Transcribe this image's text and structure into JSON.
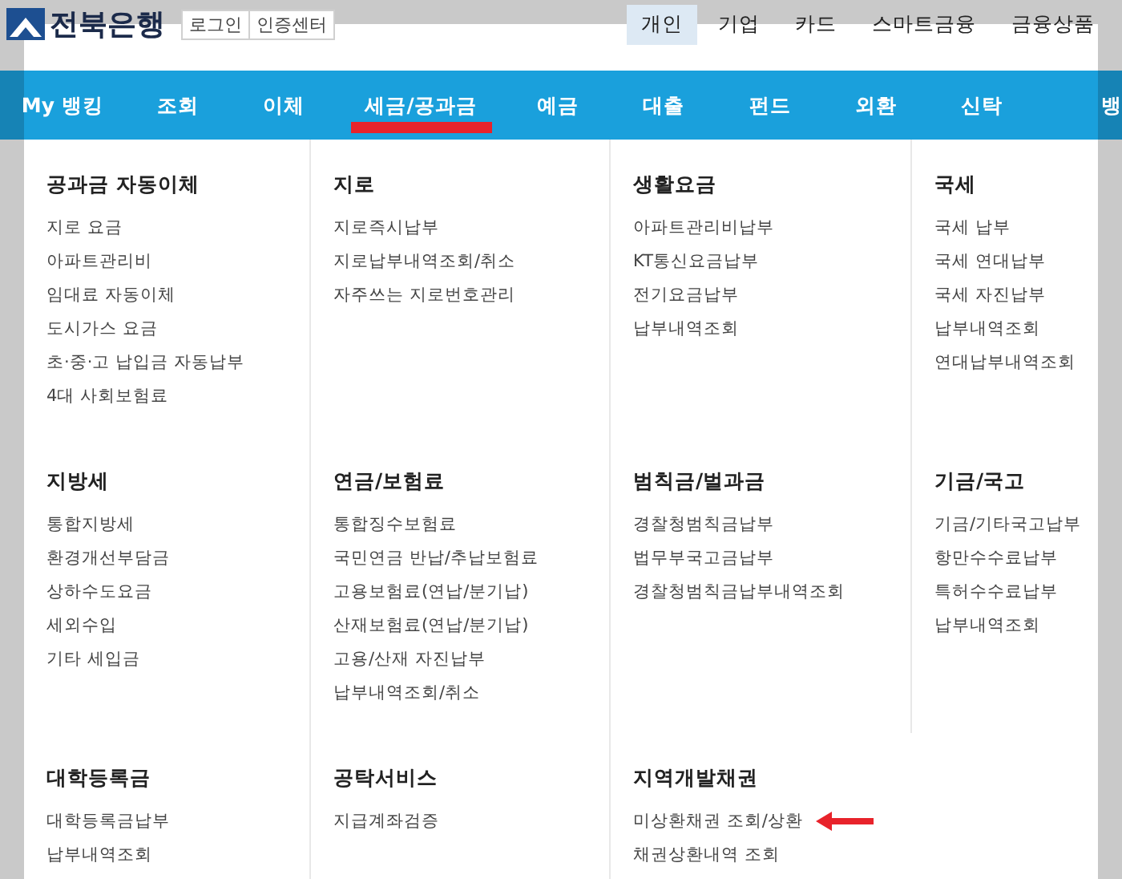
{
  "header": {
    "logo": "전북은행",
    "utility_links": [
      "로그인",
      "인증센터"
    ],
    "top_nav": [
      {
        "label": "개인",
        "selected": true
      },
      {
        "label": "기업",
        "selected": false
      },
      {
        "label": "카드",
        "selected": false
      },
      {
        "label": "스마트금융",
        "selected": false
      },
      {
        "label": "금융상품",
        "selected": false
      }
    ]
  },
  "main_nav": [
    {
      "label": "My 뱅킹",
      "marked": false
    },
    {
      "label": "조회",
      "marked": false
    },
    {
      "label": "이체",
      "marked": false
    },
    {
      "label": "세금/공과금",
      "marked": true
    },
    {
      "label": "예금",
      "marked": false
    },
    {
      "label": "대출",
      "marked": false
    },
    {
      "label": "펀드",
      "marked": false
    },
    {
      "label": "외환",
      "marked": false
    },
    {
      "label": "신탁",
      "marked": false
    },
    {
      "label": "뱅",
      "marked": false
    }
  ],
  "mega_menu": {
    "sections": [
      {
        "title": "공과금 자동이체",
        "items": [
          {
            "label": "지로 요금",
            "marked": false
          },
          {
            "label": "아파트관리비",
            "marked": false
          },
          {
            "label": "임대료 자동이체",
            "marked": false
          },
          {
            "label": "도시가스 요금",
            "marked": false
          },
          {
            "label": "초·중·고 납입금 자동납부",
            "marked": false
          },
          {
            "label": "4대 사회보험료",
            "marked": false
          }
        ]
      },
      {
        "title": "지로",
        "items": [
          {
            "label": "지로즉시납부",
            "marked": false
          },
          {
            "label": "지로납부내역조회/취소",
            "marked": false
          },
          {
            "label": "자주쓰는 지로번호관리",
            "marked": false
          }
        ]
      },
      {
        "title": "생활요금",
        "items": [
          {
            "label": "아파트관리비납부",
            "marked": false
          },
          {
            "label": "KT통신요금납부",
            "marked": false
          },
          {
            "label": "전기요금납부",
            "marked": false
          },
          {
            "label": "납부내역조회",
            "marked": false
          }
        ]
      },
      {
        "title": "국세",
        "items": [
          {
            "label": "국세 납부",
            "marked": false
          },
          {
            "label": "국세 연대납부",
            "marked": false
          },
          {
            "label": "국세 자진납부",
            "marked": false
          },
          {
            "label": "납부내역조회",
            "marked": false
          },
          {
            "label": "연대납부내역조회",
            "marked": false
          }
        ]
      },
      {
        "title": "지방세",
        "items": [
          {
            "label": "통합지방세",
            "marked": false
          },
          {
            "label": "환경개선부담금",
            "marked": false
          },
          {
            "label": "상하수도요금",
            "marked": false
          },
          {
            "label": "세외수입",
            "marked": false
          },
          {
            "label": "기타 세입금",
            "marked": false
          }
        ]
      },
      {
        "title": "연금/보험료",
        "items": [
          {
            "label": "통합징수보험료",
            "marked": false
          },
          {
            "label": "국민연금 반납/추납보험료",
            "marked": false
          },
          {
            "label": "고용보험료(연납/분기납)",
            "marked": false
          },
          {
            "label": "산재보험료(연납/분기납)",
            "marked": false
          },
          {
            "label": "고용/산재 자진납부",
            "marked": false
          },
          {
            "label": "납부내역조회/취소",
            "marked": false
          }
        ]
      },
      {
        "title": "범칙금/벌과금",
        "items": [
          {
            "label": "경찰청범칙금납부",
            "marked": false
          },
          {
            "label": "법무부국고금납부",
            "marked": false
          },
          {
            "label": "경찰청범칙금납부내역조회",
            "marked": false
          }
        ]
      },
      {
        "title": "기금/국고",
        "items": [
          {
            "label": "기금/기타국고납부",
            "marked": false
          },
          {
            "label": "항만수수료납부",
            "marked": false
          },
          {
            "label": "특허수수료납부",
            "marked": false
          },
          {
            "label": "납부내역조회",
            "marked": false
          }
        ]
      },
      {
        "title": "대학등록금",
        "items": [
          {
            "label": "대학등록금납부",
            "marked": false
          },
          {
            "label": "납부내역조회",
            "marked": false
          }
        ]
      },
      {
        "title": "공탁서비스",
        "items": [
          {
            "label": "지급계좌검증",
            "marked": false
          }
        ]
      },
      {
        "title": "지역개발채권",
        "items": [
          {
            "label": "미상환채권 조회/상환",
            "marked": true
          },
          {
            "label": "채권상환내역 조회",
            "marked": false
          }
        ]
      }
    ]
  }
}
